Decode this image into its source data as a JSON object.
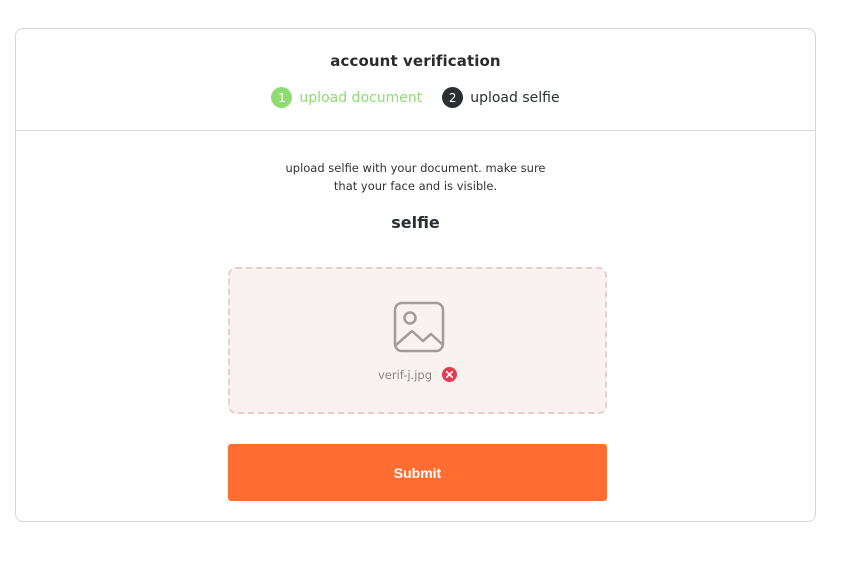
{
  "card": {
    "title": "account verification",
    "steps": [
      {
        "number": "1",
        "label": "upload document",
        "state": "done"
      },
      {
        "number": "2",
        "label": "upload selfie",
        "state": "active"
      }
    ]
  },
  "upload": {
    "instructions_line1": "upload selfie with your document. make sure",
    "instructions_line2": "that your face and is visible.",
    "section_label": "selfie",
    "file_name": "verif-j.jpg",
    "icon": "image-icon",
    "remove_icon": "close-circle-icon"
  },
  "actions": {
    "submit_label": "Submit"
  },
  "colors": {
    "accent": "#ff6d30",
    "step_done": "#8fdc72",
    "step_active": "#2a2f33",
    "error": "#e8394d"
  }
}
